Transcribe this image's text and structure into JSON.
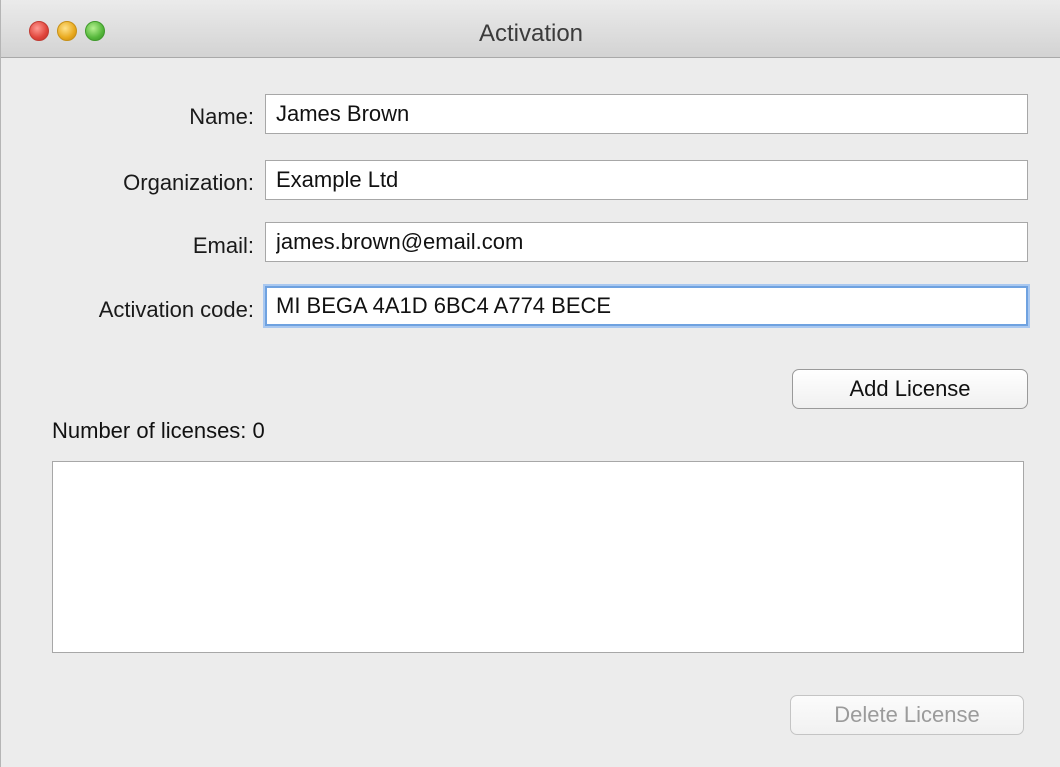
{
  "window": {
    "title": "Activation"
  },
  "form": {
    "name_label": "Name:",
    "name_value": "James Brown",
    "organization_label": "Organization:",
    "organization_value": "Example Ltd",
    "email_label": "Email:",
    "email_value": "james.brown@email.com",
    "activation_label": "Activation code:",
    "activation_value": "MI BEGA 4A1D 6BC4 A774 BECE"
  },
  "buttons": {
    "add_license": "Add License",
    "delete_license": "Delete License"
  },
  "licenses": {
    "count_label": "Number of licenses:",
    "count": "0",
    "items": []
  }
}
